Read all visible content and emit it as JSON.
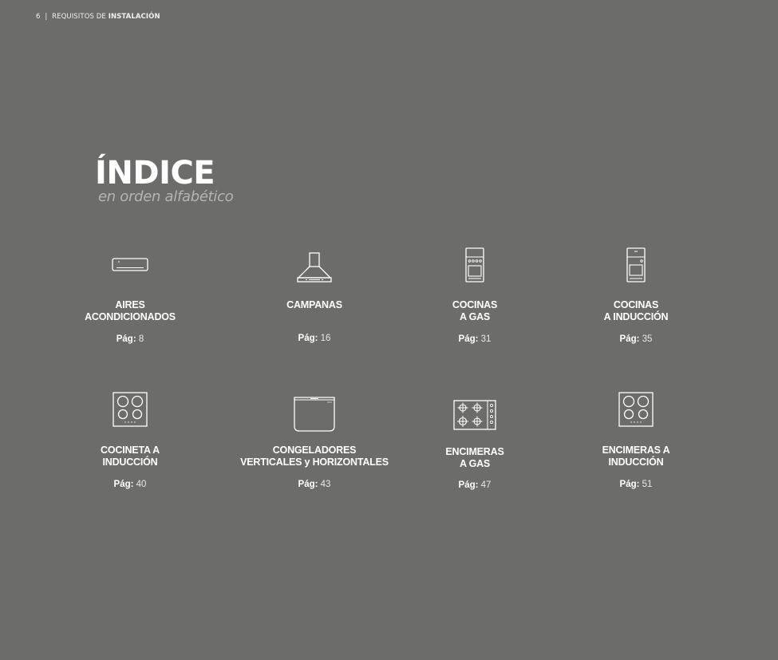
{
  "header": {
    "page_number": "6",
    "separator": "|",
    "section_prefix": "REQUISITOS DE",
    "section_bold": "INSTALACIÓN"
  },
  "title": "ÍNDICE",
  "subtitle": "en orden alfabético",
  "page_label": "Pág:",
  "items": [
    {
      "line1": "AIRES",
      "line2": "ACONDICIONADOS",
      "page": "8",
      "icon": "air-conditioner-icon"
    },
    {
      "line1": "CAMPANAS",
      "line2": "",
      "page": "16",
      "icon": "range-hood-icon"
    },
    {
      "line1": "COCINAS",
      "line2": "A GAS",
      "page": "31",
      "icon": "gas-stove-icon"
    },
    {
      "line1": "COCINAS",
      "line2": "A INDUCCIÓN",
      "page": "35",
      "icon": "induction-stove-icon"
    },
    {
      "line1": "COCINETA A",
      "line2": "INDUCCIÓN",
      "page": "40",
      "icon": "induction-cooktop-icon"
    },
    {
      "line1": "CONGELADORES",
      "line2": "VERTICALES y HORIZONTALES",
      "page": "43",
      "icon": "freezer-icon"
    },
    {
      "line1": "ENCIMERAS",
      "line2": "A GAS",
      "page": "47",
      "icon": "gas-hob-icon"
    },
    {
      "line1": "ENCIMERAS A",
      "line2": "INDUCCIÓN",
      "page": "51",
      "icon": "induction-hob-icon"
    }
  ]
}
